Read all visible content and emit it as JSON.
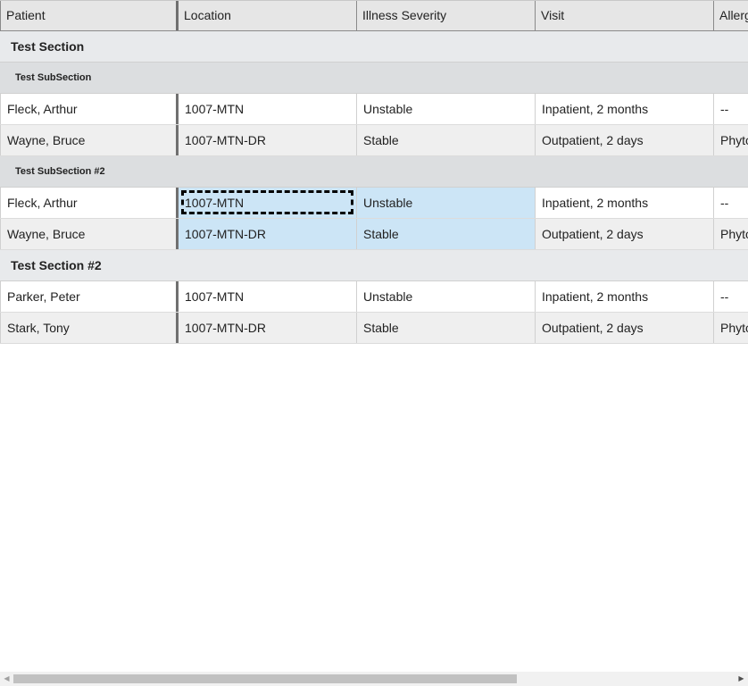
{
  "columns": [
    "Patient",
    "Location",
    "Illness Severity",
    "Visit",
    "Allergies"
  ],
  "sections": [
    {
      "label": "Test Section",
      "subsections": [
        {
          "label": "Test SubSection",
          "rows": [
            [
              "Fleck, Arthur",
              "1007-MTN",
              "Unstable",
              "Inpatient, 2 months",
              "--"
            ],
            [
              "Wayne, Bruce",
              "1007-MTN-DR",
              "Stable",
              "Outpatient, 2 days",
              "Phytochemicals"
            ]
          ]
        },
        {
          "label": "Test SubSection #2",
          "rows": [
            [
              "Fleck, Arthur",
              "1007-MTN",
              "Unstable",
              "Inpatient, 2 months",
              "--"
            ],
            [
              "Wayne, Bruce",
              "1007-MTN-DR",
              "Stable",
              "Outpatient, 2 days",
              "Phytochemicals"
            ]
          ]
        }
      ]
    },
    {
      "label": "Test Section #2",
      "rows": [
        [
          "Parker, Peter",
          "1007-MTN",
          "Unstable",
          "Inpatient, 2 months",
          "--"
        ],
        [
          "Stark, Tony",
          "1007-MTN-DR",
          "Stable",
          "Outpatient, 2 days",
          "Phytochemicals"
        ]
      ]
    }
  ],
  "selection": {
    "focused_cell": "Test SubSection #2, row 1, Location",
    "selected_range": "Location to Illness Severity, 2 rows"
  },
  "colors": {
    "selected": "#cce5f6",
    "header_bg": "#e6e6e6",
    "section_bg": "#e8eaec",
    "subsection_bg": "#dcdee0"
  },
  "scrollbar": {
    "horizontal_position": 0.0,
    "left_arrow": "scroll-left-icon",
    "right_arrow": "scroll-right-icon"
  }
}
